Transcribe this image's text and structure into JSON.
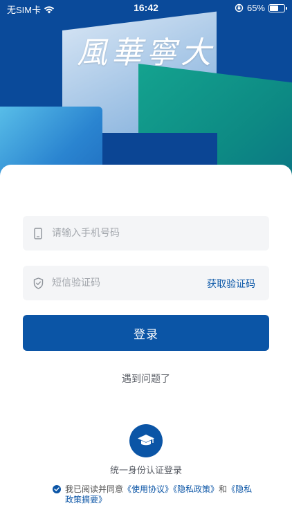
{
  "status_bar": {
    "carrier": "无SIM卡",
    "time": "16:42",
    "battery": "65%",
    "battery_level": 0.65
  },
  "hero": {
    "logo": "風華寧大"
  },
  "form": {
    "phone_placeholder": "请输入手机号码",
    "code_placeholder": "短信验证码",
    "get_code_label": "获取验证码",
    "login_label": "登录"
  },
  "help": {
    "problem_label": "遇到问题了"
  },
  "sso": {
    "label": "统一身份认证登录"
  },
  "agreement": {
    "prefix": "我已阅读并同意",
    "terms": "《使用协议》",
    "privacy": "《隐私政策》",
    "and": "和",
    "privacy_summary": "《隐私政策摘要》"
  },
  "colors": {
    "primary": "#0b55a6",
    "hero_bg": "#0a4a9a",
    "field_bg": "#f4f5f7"
  }
}
